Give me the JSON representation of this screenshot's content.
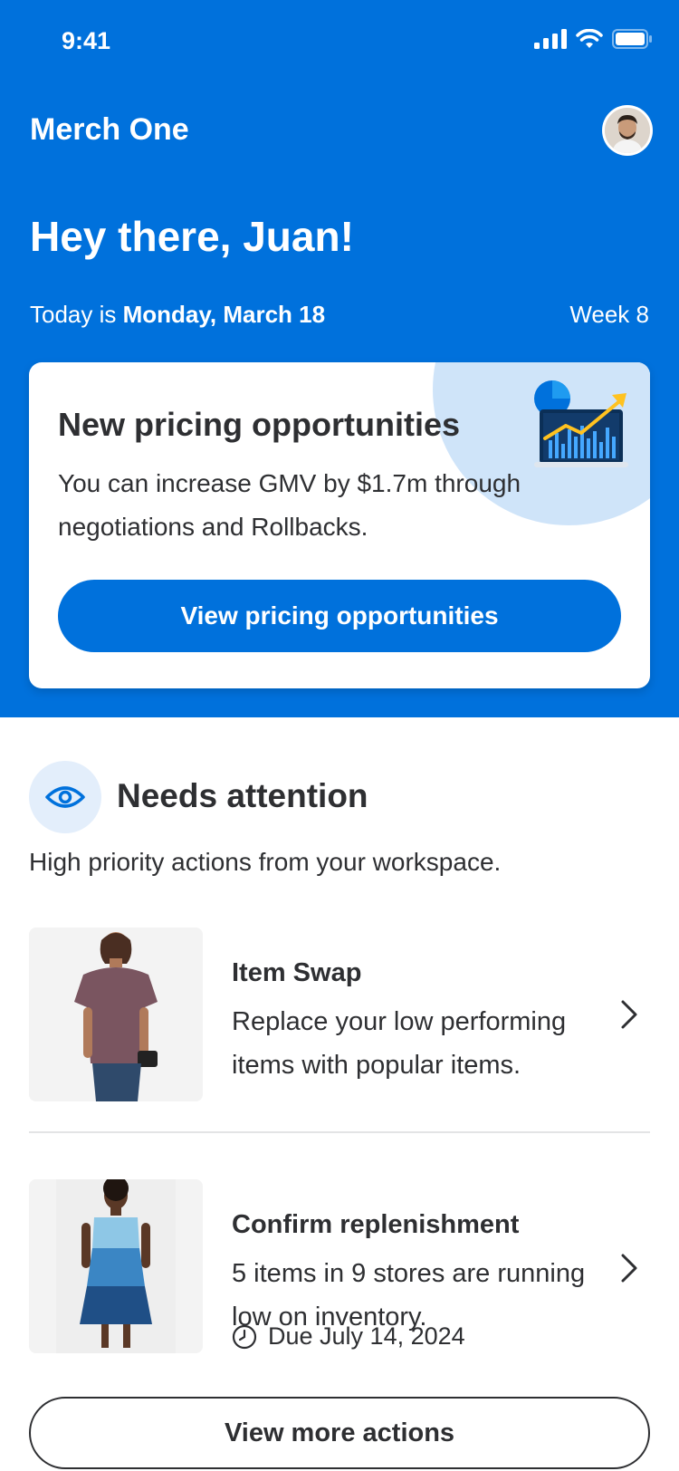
{
  "status_bar": {
    "time": "9:41"
  },
  "header": {
    "app_title": "Merch One",
    "greeting": "Hey there, Juan!",
    "date_prefix": "Today is ",
    "date": "Monday, March 18",
    "week": "Week 8"
  },
  "promo": {
    "title": "New pricing opportunities",
    "text": "You can increase GMV by $1.7m through negotiations and Rollbacks.",
    "button_label": "View pricing opportunities"
  },
  "attention": {
    "title": "Needs attention",
    "subtitle": "High priority actions from your workspace."
  },
  "tasks": [
    {
      "title": "Item Swap",
      "description": "Replace your low performing items with popular items."
    },
    {
      "title": "Confirm replenishment",
      "description": "5 items in 9 stores are running low on inventory.",
      "due": "Due July 14, 2024"
    }
  ],
  "more_button_label": "View more actions",
  "colors": {
    "brand_blue": "#0071dc",
    "light_blue": "#cfe4f9",
    "text_dark": "#2e2f32",
    "accent_yellow": "#ffc220"
  }
}
